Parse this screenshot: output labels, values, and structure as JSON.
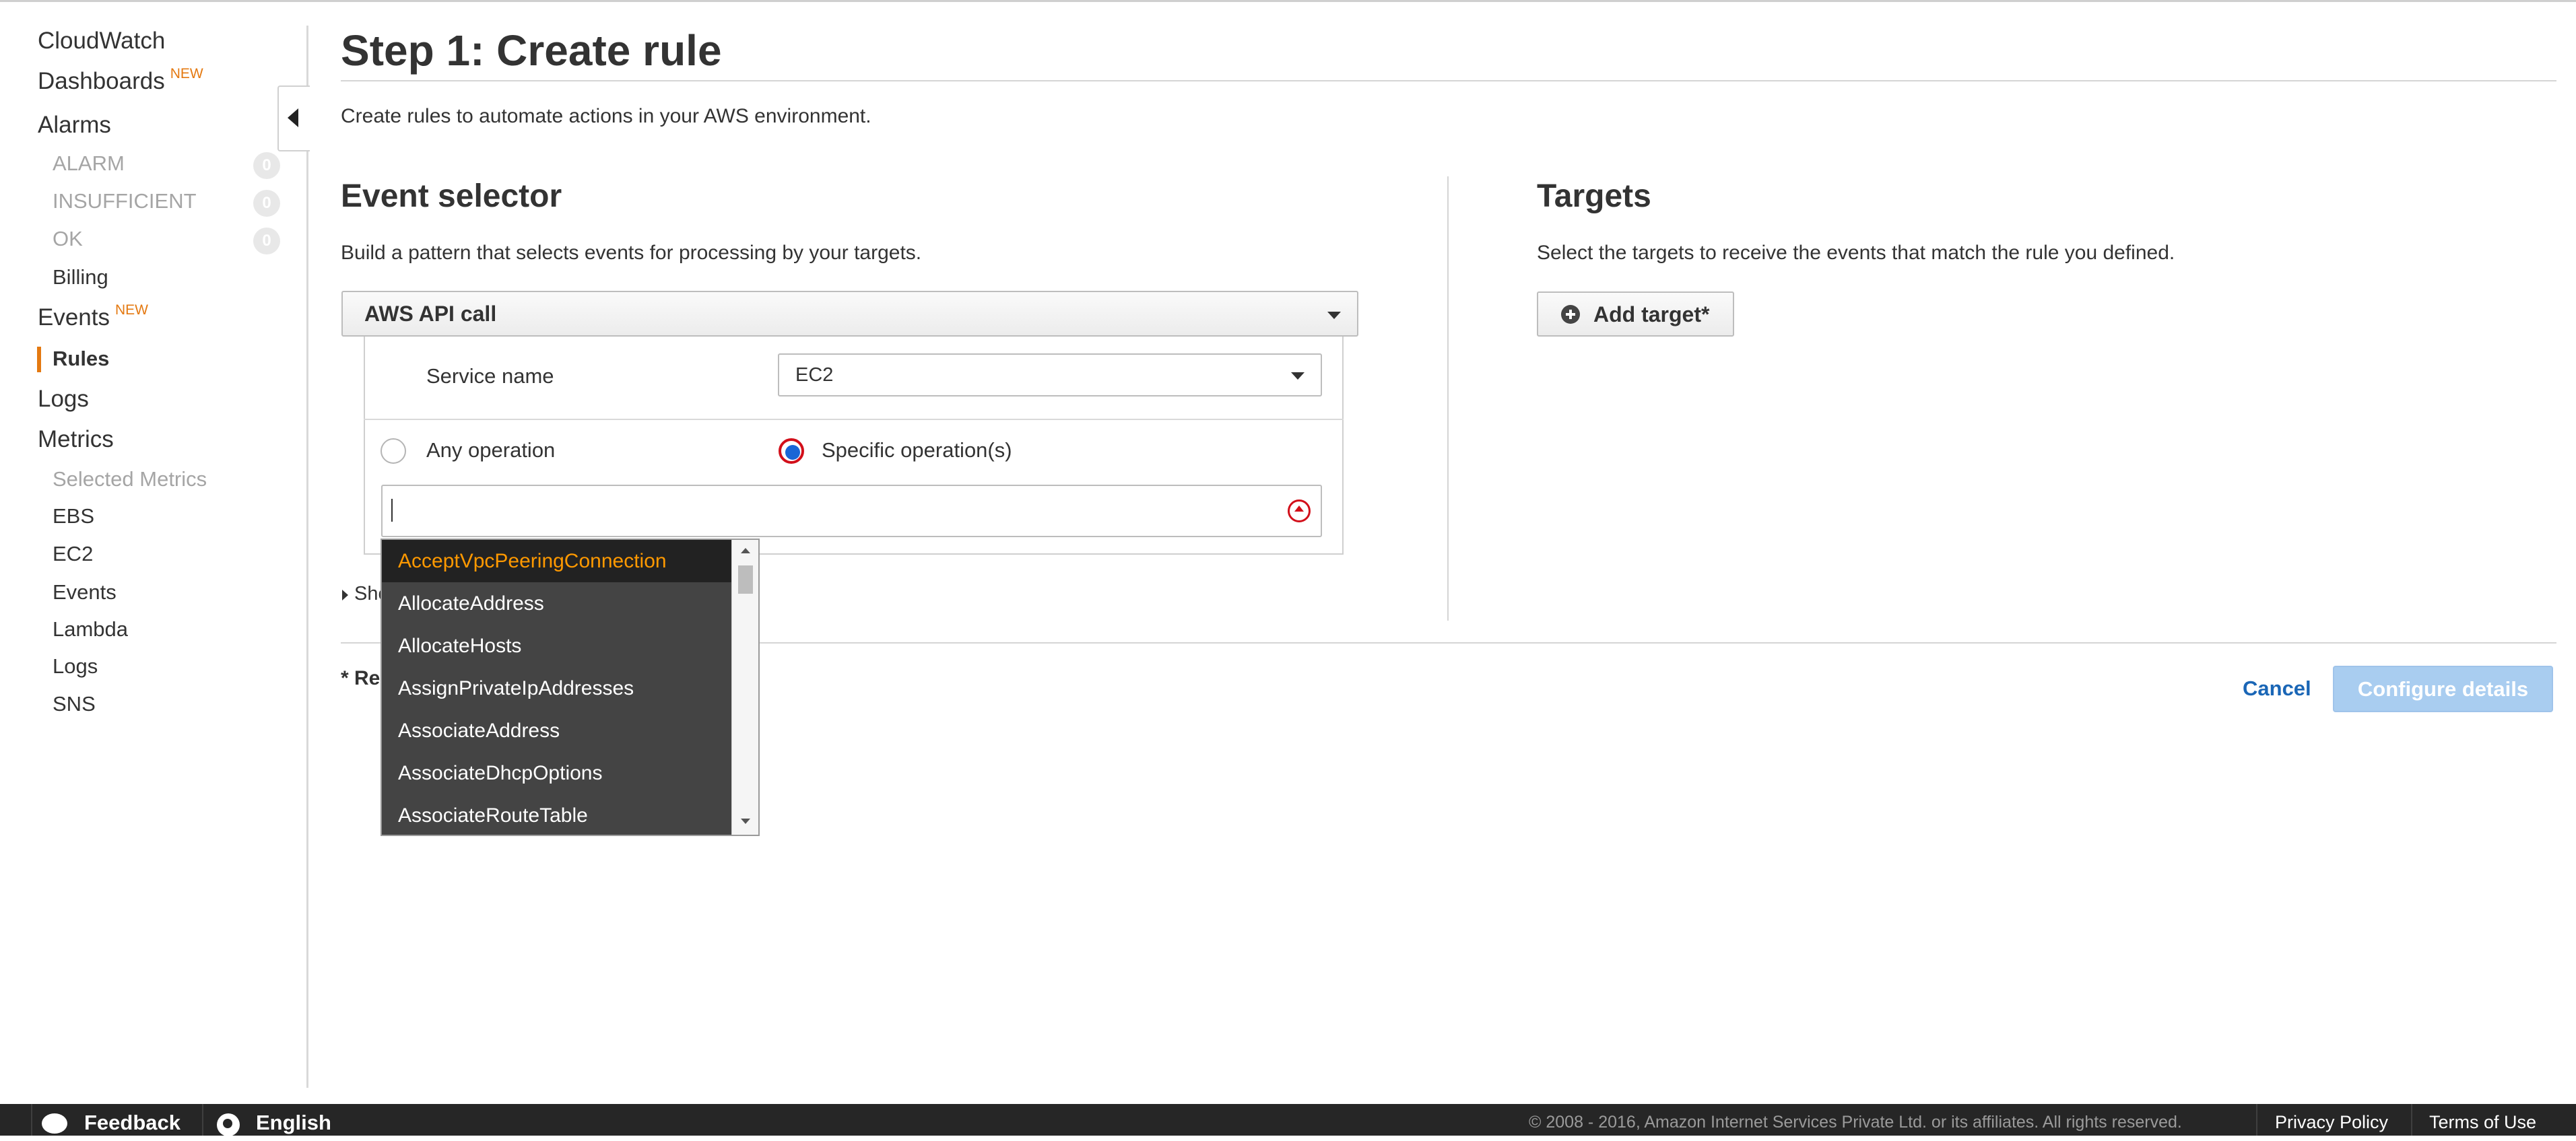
{
  "sidebar": {
    "cloudwatch": "CloudWatch",
    "dashboards": "Dashboards",
    "new_badge": "NEW",
    "alarms": "Alarms",
    "alarm_states": [
      {
        "label": "ALARM",
        "count": "0"
      },
      {
        "label": "INSUFFICIENT",
        "count": "0"
      },
      {
        "label": "OK",
        "count": "0"
      }
    ],
    "billing": "Billing",
    "events": "Events",
    "rules": "Rules",
    "logs": "Logs",
    "metrics": "Metrics",
    "selected_metrics": "Selected Metrics",
    "metric_items": [
      "EBS",
      "EC2",
      "Events",
      "Lambda",
      "Logs",
      "SNS"
    ]
  },
  "main": {
    "title": "Step 1: Create rule",
    "description": "Create rules to automate actions in your AWS environment.",
    "event_selector": {
      "heading": "Event selector",
      "description": "Build a pattern that selects events for processing by your targets.",
      "source_select": "AWS API call",
      "service_label": "Service name",
      "service_value": "EC2",
      "any_operation": "Any operation",
      "specific_operation": "Specific operation(s)",
      "operation_input_value": "",
      "show_advanced": "Show advanced options",
      "required_note": "* Required"
    },
    "operations_dropdown": [
      "AcceptVpcPeeringConnection",
      "AllocateAddress",
      "AllocateHosts",
      "AssignPrivateIpAddresses",
      "AssociateAddress",
      "AssociateDhcpOptions",
      "AssociateRouteTable"
    ],
    "targets": {
      "heading": "Targets",
      "description": "Select the targets to receive the events that match the rule you defined.",
      "add_target": "Add target*"
    },
    "actions": {
      "cancel": "Cancel",
      "configure": "Configure details"
    }
  },
  "footer": {
    "feedback": "Feedback",
    "language": "English",
    "copyright": "© 2008 - 2016, Amazon Internet Services Private Ltd. or its affiliates. All rights reserved.",
    "privacy": "Privacy Policy",
    "terms": "Terms of Use"
  },
  "colors": {
    "accent_orange": "#e47911",
    "link_blue": "#1a66b6",
    "radio_selected": "#1a66d6",
    "focus_red": "#d20f1a",
    "footer_bg": "#262626"
  }
}
